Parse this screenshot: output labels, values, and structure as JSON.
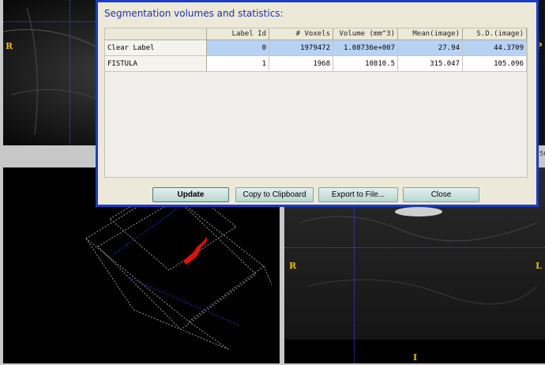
{
  "viewer": {
    "top_left": {
      "orient_right_label": "R"
    },
    "top_right": {
      "orient_left_label": "P",
      "edge_text": "256"
    },
    "bottom_right": {
      "left_label": "R",
      "right_label": "L",
      "bottom_label": "I"
    }
  },
  "dialog": {
    "title": "Segmentation volumes and statistics:",
    "columns": [
      "",
      "Label Id",
      "# Voxels",
      "Volume (mm^3)",
      "Mean(image)",
      "S.D.(image)"
    ],
    "rows": [
      {
        "name": "Clear Label",
        "label_id": "0",
        "voxels": "1979472",
        "volume": "1.08736e+007",
        "mean": "27.94",
        "sd": "44.3709",
        "selected": true
      },
      {
        "name": "FISTULA",
        "label_id": "1",
        "voxels": "1968",
        "volume": "10810.5",
        "mean": "315.047",
        "sd": "105.096",
        "selected": false
      }
    ],
    "buttons": {
      "update": "Update",
      "copy": "Copy to Clipboard",
      "export": "Export to File...",
      "close": "Close"
    }
  }
}
